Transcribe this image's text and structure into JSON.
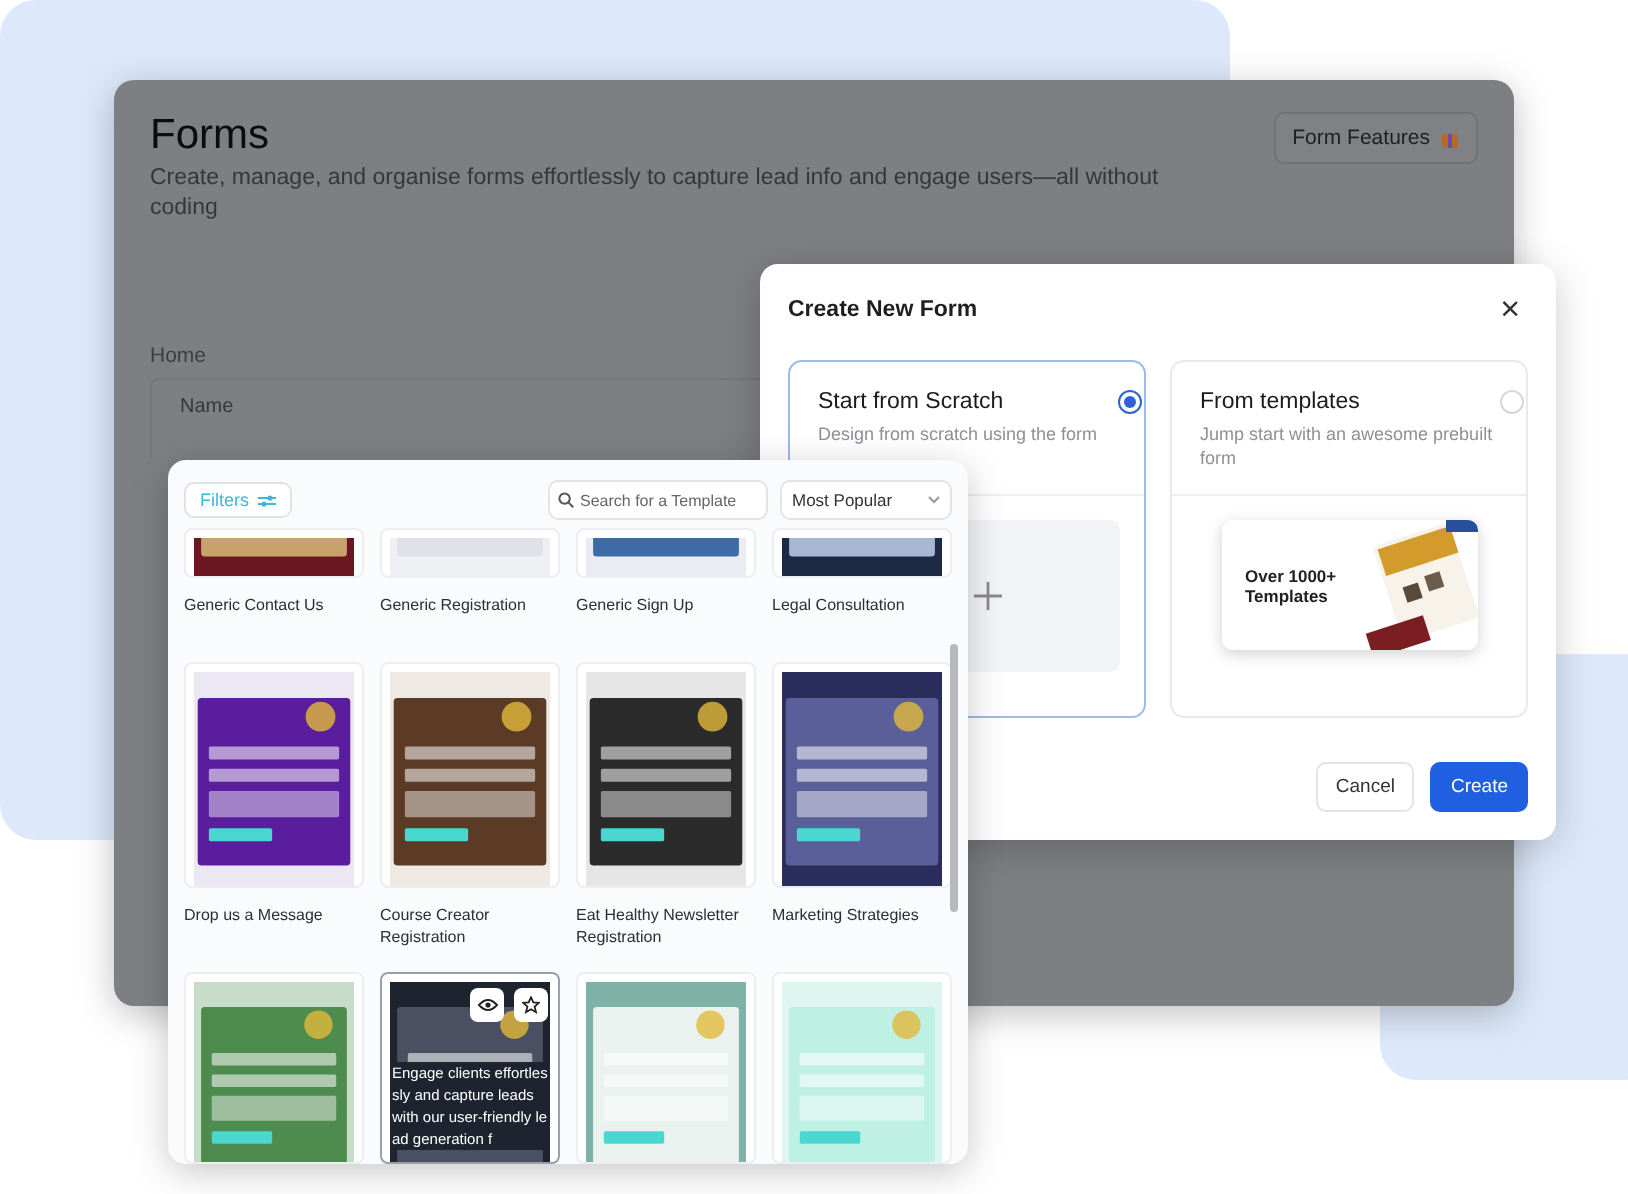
{
  "page": {
    "title": "Forms",
    "subtitle": "Create, manage, and organise forms effortlessly to capture lead info and engage users—all without coding",
    "feature_button": "Form Features",
    "breadcrumb": "Home",
    "table_header": "Name"
  },
  "dialog": {
    "title": "Create New Form",
    "close": "×",
    "options": [
      {
        "kind": "scratch",
        "title": "Start from Scratch",
        "description": "Design from scratch using the form",
        "selected": true
      },
      {
        "kind": "templates",
        "title": "From templates",
        "description": "Jump start with an awesome prebuilt form",
        "selected": false,
        "promo": "Over 1000+ Templates"
      }
    ],
    "buttons": [
      {
        "kind": "secondary",
        "label": "Cancel"
      },
      {
        "kind": "primary",
        "label": "Create"
      }
    ]
  },
  "template_browser": {
    "filter_button": "Filters",
    "search": {
      "placeholder": "Search for a Template"
    },
    "sort": "Most Popular",
    "rows": [
      {
        "templates": [
          {
            "name": "Generic Contact Us",
            "hovered": false
          },
          {
            "name": "Generic Registration",
            "hovered": false
          },
          {
            "name": "Generic Sign Up",
            "hovered": false
          },
          {
            "name": "Legal Consultation",
            "hovered": false
          }
        ]
      },
      {
        "templates": [
          {
            "name": "Drop us a Message",
            "hovered": false
          },
          {
            "name": "Course Creator Registration",
            "hovered": false
          },
          {
            "name": "Eat Healthy Newsletter Registration",
            "hovered": false
          },
          {
            "name": "Marketing Strategies",
            "hovered": false
          }
        ]
      },
      {
        "templates": [
          {
            "hovered": false
          },
          {
            "hovered": true,
            "overlay_text": "Engage clients effortlessly and capture leads with our user-friendly lead generation f"
          },
          {
            "hovered": false
          },
          {
            "hovered": false
          }
        ]
      }
    ]
  }
}
